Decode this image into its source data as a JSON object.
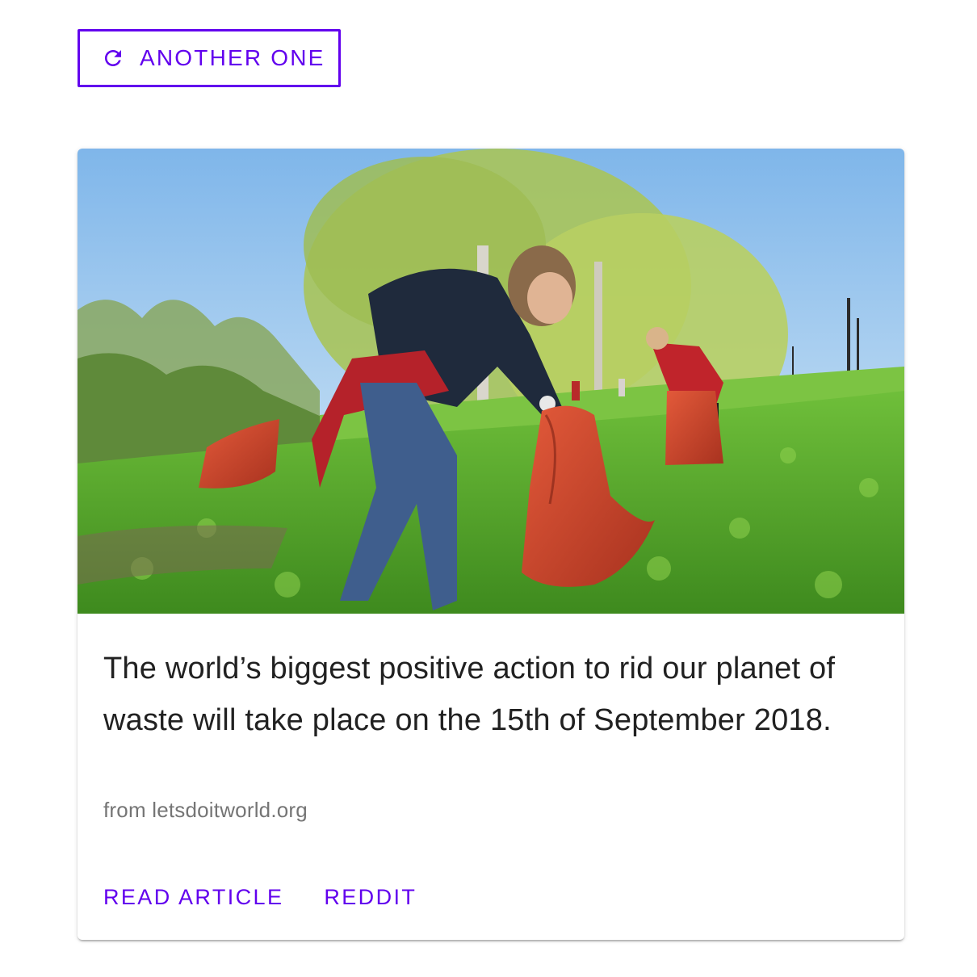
{
  "toolbar": {
    "another_label": "ANOTHER ONE",
    "another_icon": "refresh-icon"
  },
  "card": {
    "image_description": "volunteers-collecting-waste-in-field-photo",
    "title": "The world’s biggest positive action to rid our planet of waste will take place on the 15th of September 2018.",
    "source": "from letsdoitworld.org",
    "actions": {
      "read_article": "READ ARTICLE",
      "reddit": "REDDIT"
    }
  },
  "colors": {
    "accent": "#6200ee",
    "title": "#212121",
    "secondary_text": "#757575"
  }
}
